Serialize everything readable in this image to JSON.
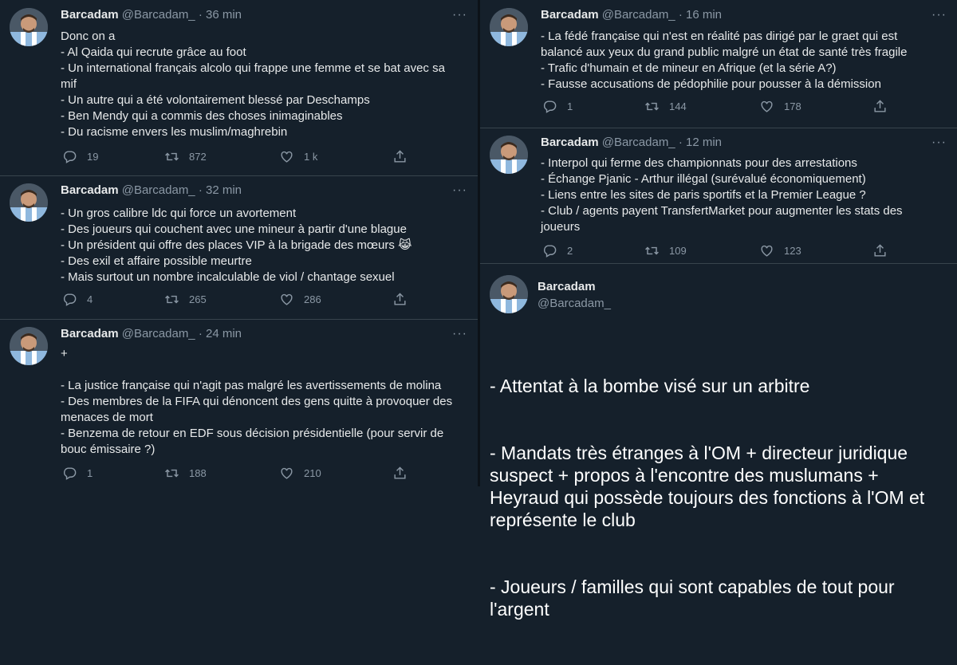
{
  "author": {
    "name": "Barcadam",
    "handle": "@Barcadam_"
  },
  "left_tweets": [
    {
      "time": "36 min",
      "lines": [
        "Donc on a",
        "- Al Qaida qui recrute grâce au foot",
        "- Un international français alcolo qui frappe une femme et se bat avec sa mif",
        "- Un autre qui a été volontairement blessé par Deschamps",
        "- Ben Mendy qui a commis des choses inimaginables",
        "- Du racisme envers les muslim/maghrebin"
      ],
      "replies": "19",
      "retweets": "872",
      "likes": "1 k"
    },
    {
      "time": "32 min",
      "lines": [
        "- Un gros calibre ldc qui force un avortement",
        "- Des joueurs qui couchent avec une mineur à partir d'une blague",
        "- Un président qui offre des places VIP à la brigade des mœurs 😹",
        "- Des exil et affaire possible meurtre",
        "- Mais surtout un nombre incalculable de viol / chantage sexuel"
      ],
      "replies": "4",
      "retweets": "265",
      "likes": "286"
    },
    {
      "time": "24 min",
      "lines": [
        "+",
        "",
        "- La justice française qui n'agit pas malgré les avertissements de molina",
        "- Des membres de la FIFA qui dénoncent des gens quitte à provoquer des menaces de mort",
        "- Benzema de retour en EDF sous décision présidentielle (pour servir de bouc émissaire ?)"
      ],
      "replies": "1",
      "retweets": "188",
      "likes": "210"
    }
  ],
  "right_tweets": [
    {
      "time": "16 min",
      "lines": [
        "- La fédé française qui n'est en réalité pas dirigé par le graet qui est balancé aux yeux du grand public malgré un état de santé très fragile",
        "- Trafic d'humain et de mineur en Afrique (et la série A?)",
        "- Fausse accusations de pédophilie pour pousser à la démission"
      ],
      "replies": "1",
      "retweets": "144",
      "likes": "178"
    },
    {
      "time": "12 min",
      "lines": [
        "- Interpol qui ferme des championnats pour des arrestations",
        "- Échange Pjanic - Arthur illégal (surévalué économiquement)",
        "- Liens entre les sites de paris sportifs et la Premier League ?",
        "- Club / agents payent TransfertMarket pour augmenter les stats des joueurs"
      ],
      "replies": "2",
      "retweets": "109",
      "likes": "123"
    }
  ],
  "focused_tweet": {
    "lines": [
      "- Attentat à la bombe visé sur un arbitre",
      "- Mandats très étranges à l'OM + directeur juridique suspect + propos à l'encontre des muslumans + Heyraud qui possède toujours des fonctions à l'OM et représente le club",
      "- Joueurs / familles qui sont capables de tout pour l'argent"
    ]
  },
  "ui": {
    "dot": "·",
    "more": "···"
  },
  "colors": {
    "background": "#15202b",
    "text": "#e7e9ea",
    "muted": "#8b98a5",
    "border": "#38444d"
  }
}
